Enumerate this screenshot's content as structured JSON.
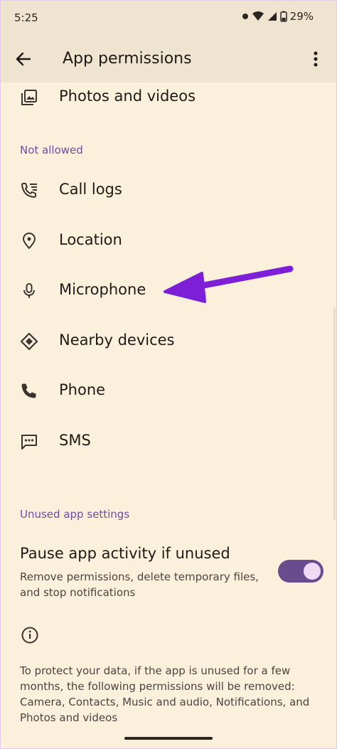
{
  "status_bar": {
    "time": "5:25",
    "battery": "29%"
  },
  "app_bar": {
    "title": "App permissions"
  },
  "allowed_items": [
    {
      "label": "Photos and videos",
      "icon": "photos-icon"
    }
  ],
  "not_allowed": {
    "header": "Not allowed",
    "items": [
      {
        "label": "Call logs",
        "icon": "call-log-icon"
      },
      {
        "label": "Location",
        "icon": "location-icon"
      },
      {
        "label": "Microphone",
        "icon": "microphone-icon"
      },
      {
        "label": "Nearby devices",
        "icon": "nearby-devices-icon"
      },
      {
        "label": "Phone",
        "icon": "phone-icon"
      },
      {
        "label": "SMS",
        "icon": "sms-icon"
      }
    ]
  },
  "unused_settings": {
    "header": "Unused app settings",
    "pause_title": "Pause app activity if unused",
    "pause_subtitle": "Remove permissions, delete temporary files, and stop notifications",
    "toggle_on": true
  },
  "info": {
    "text": "To protect your data, if the app is unused for a few months, the following permissions will be removed: Camera, Contacts, Music and audio, Notifications, and Photos and videos"
  },
  "colors": {
    "background": "#fbf0db",
    "app_bar": "#efe4d0",
    "accent": "#6b4ea0",
    "toggle_track": "#6a4b8d",
    "annotation_arrow": "#7d1fd6"
  }
}
